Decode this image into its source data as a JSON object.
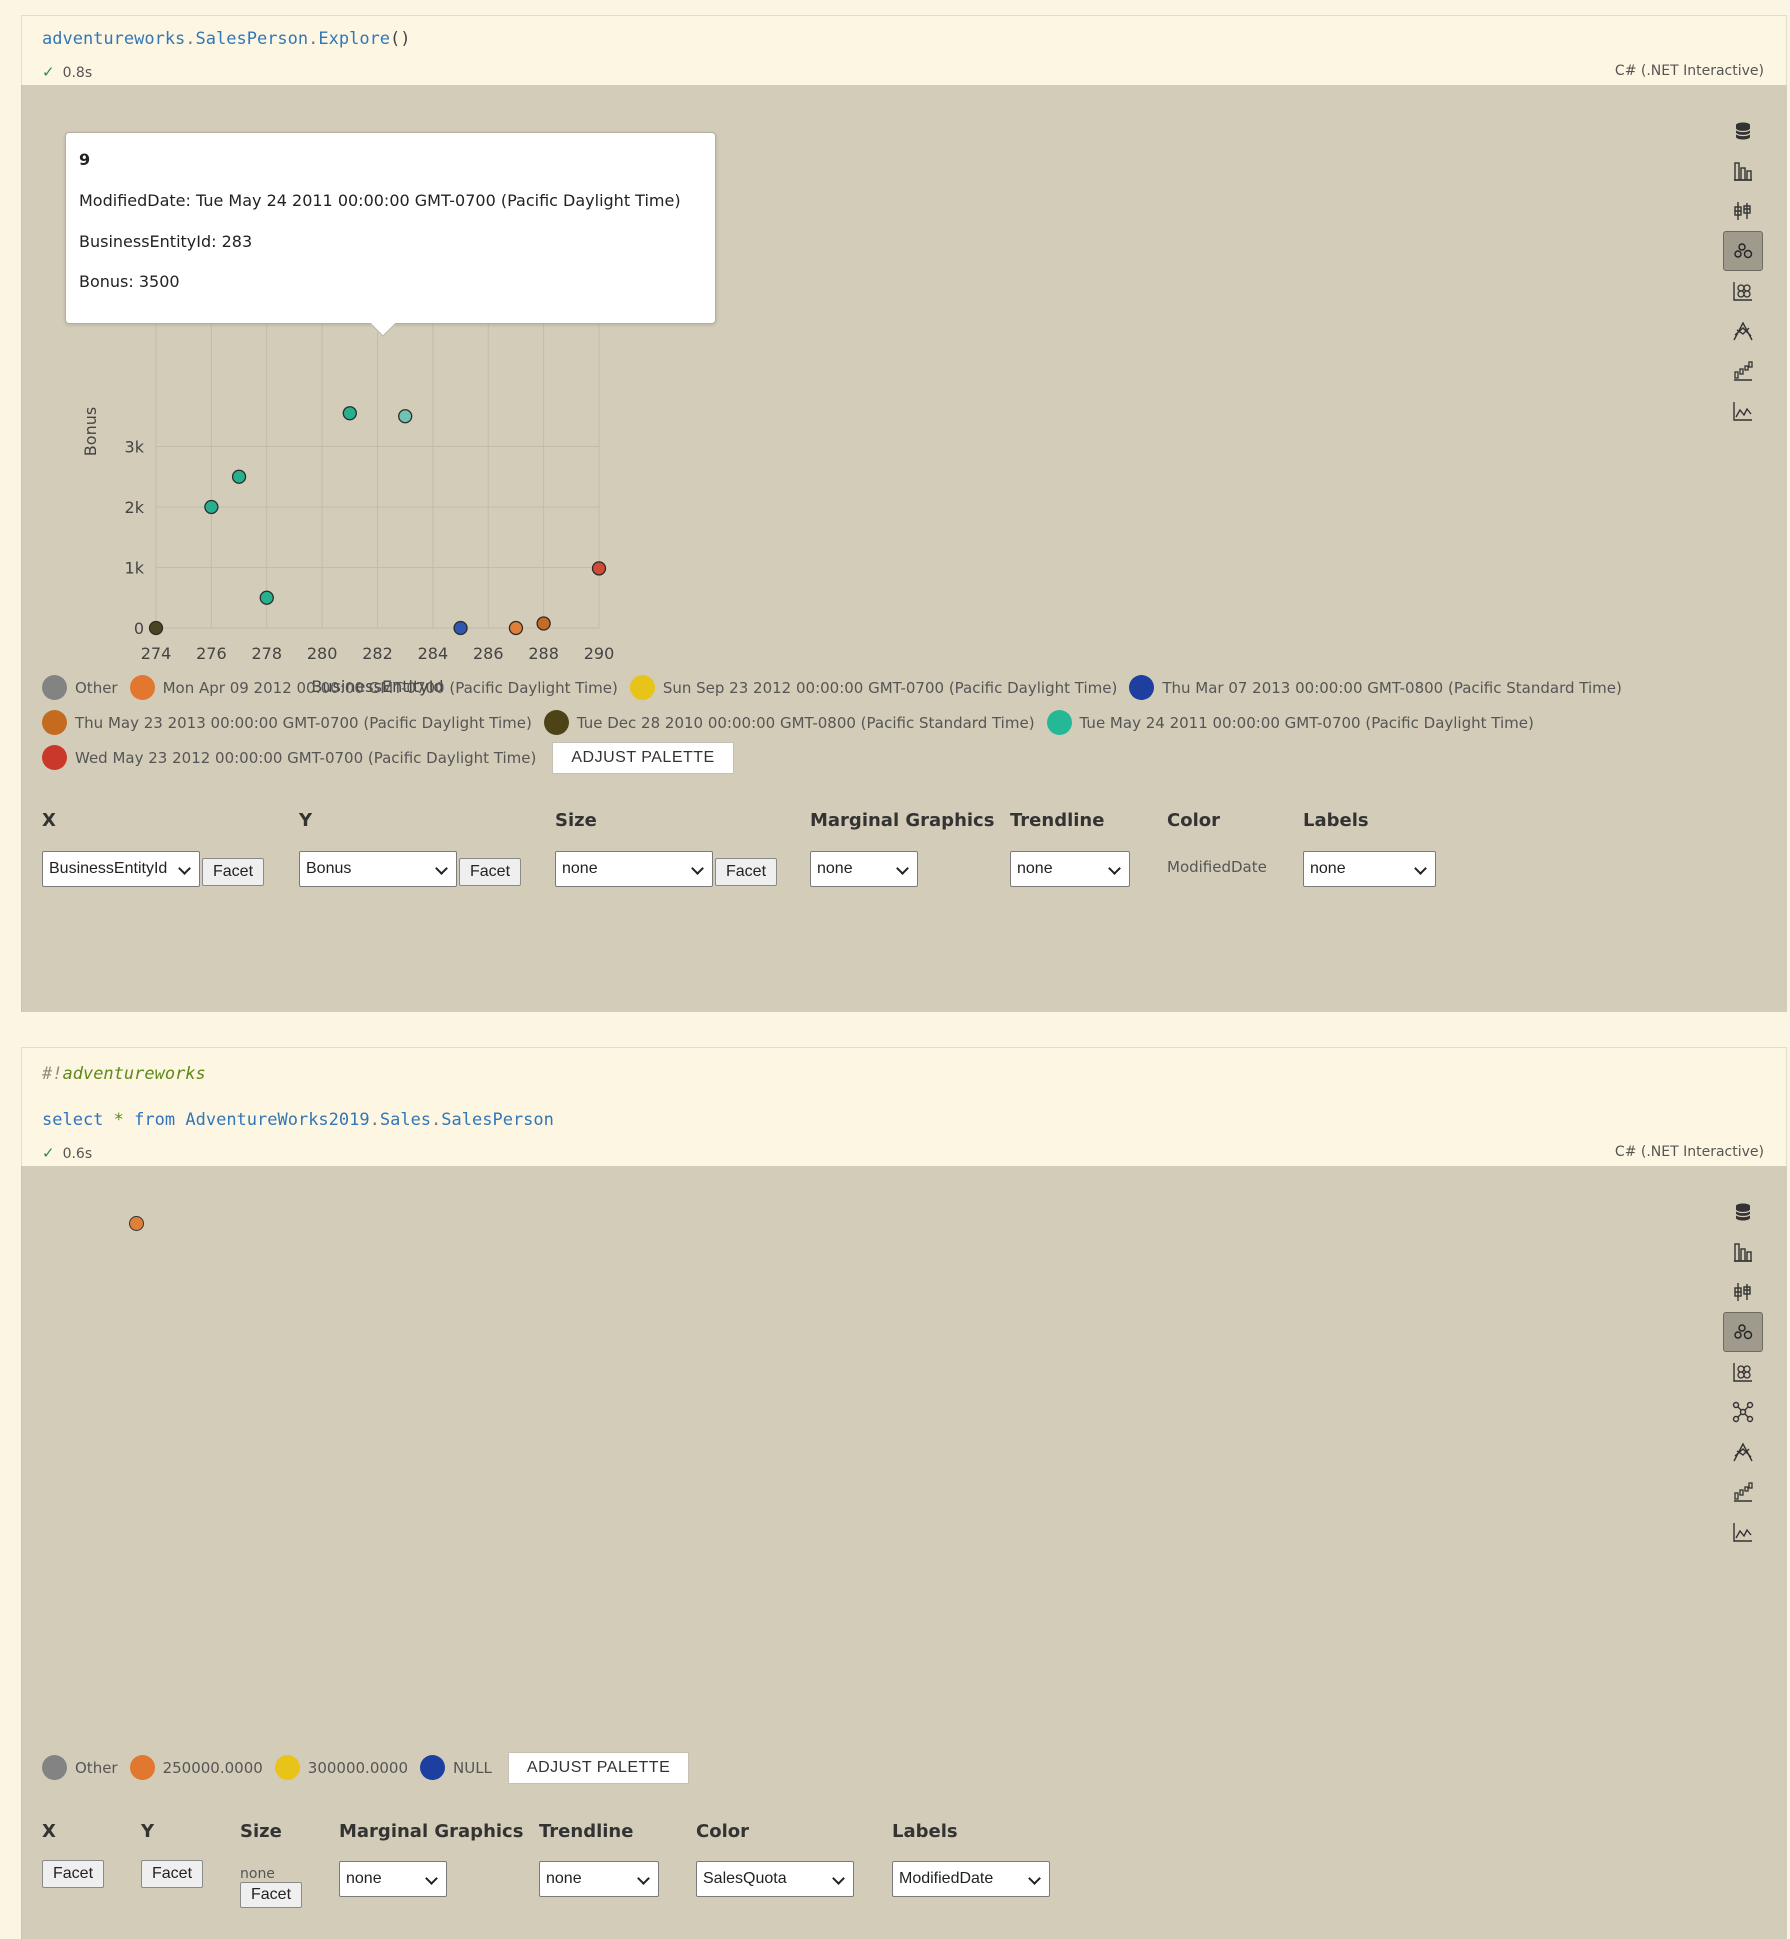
{
  "cell1": {
    "code": {
      "obj": "adventureworks",
      "dot1": ".",
      "table": "SalesPerson",
      "dot2": ".",
      "method": "Explore",
      "parens": "()"
    },
    "status": {
      "check": "✓",
      "time": "0.8s"
    },
    "language": "C# (.NET Interactive)",
    "tooltip": {
      "title": "9",
      "lines": [
        "ModifiedDate: Tue May 24 2011 00:00:00 GMT-0700 (Pacific Daylight Time)",
        "BusinessEntityId: 283",
        "Bonus: 3500"
      ]
    },
    "chart_data": {
      "type": "scatter",
      "xlabel": "BusinessEntityId",
      "ylabel": "Bonus",
      "xlim": [
        274,
        290
      ],
      "ylim": [
        0,
        3500
      ],
      "x_ticks": [
        "274",
        "276",
        "278",
        "280",
        "282",
        "284",
        "286",
        "288",
        "290"
      ],
      "y_ticks": [
        "0",
        "1k",
        "2k",
        "3k"
      ],
      "grid": true,
      "points": [
        {
          "x": 274,
          "y": 0,
          "color": "#4a4520"
        },
        {
          "x": 276,
          "y": 2000,
          "color": "#27b08e"
        },
        {
          "x": 277,
          "y": 2500,
          "color": "#27b08e"
        },
        {
          "x": 278,
          "y": 500,
          "color": "#27b08e"
        },
        {
          "x": 281,
          "y": 3550,
          "color": "#27b08e"
        },
        {
          "x": 283,
          "y": 3500,
          "color": "#6fc3b0"
        },
        {
          "x": 285,
          "y": 0,
          "color": "#2f56b0"
        },
        {
          "x": 287,
          "y": 0,
          "color": "#e07f3a"
        },
        {
          "x": 288,
          "y": 75,
          "color": "#c46d22"
        },
        {
          "x": 290,
          "y": 985,
          "color": "#d14a33"
        }
      ]
    },
    "legend_rows": [
      [
        {
          "label": "Other",
          "color": "#838383"
        },
        {
          "label": "Mon Apr 09 2012 00:00:00 GMT-0700 (Pacific Daylight Time)",
          "color": "#e2772f"
        },
        {
          "label": "Sun Sep 23 2012 00:00:00 GMT-0700 (Pacific Daylight Time)",
          "color": "#e8c318"
        },
        {
          "label": "Thu Mar 07 2013 00:00:00 GMT-0800 (Pacific Standard Time)",
          "color": "#1c3fa0"
        }
      ],
      [
        {
          "label": "Thu May 23 2013 00:00:00 GMT-0700 (Pacific Daylight Time)",
          "color": "#c46b1f"
        },
        {
          "label": "Tue Dec 28 2010 00:00:00 GMT-0800 (Pacific Standard Time)",
          "color": "#4c4416"
        },
        {
          "label": "Tue May 24 2011 00:00:00 GMT-0700 (Pacific Daylight Time)",
          "color": "#24b896"
        }
      ],
      [
        {
          "label": "Wed May 23 2012 00:00:00 GMT-0700 (Pacific Daylight Time)",
          "color": "#c9382a"
        }
      ]
    ],
    "adjust_palette": "ADJUST PALETTE",
    "controls": {
      "x_label": "X",
      "y_label": "Y",
      "size_label": "Size",
      "marginal_label": "Marginal Graphics",
      "trendline_label": "Trendline",
      "color_label": "Color",
      "labels_label": "Labels",
      "x_value": "BusinessEntityId",
      "y_value": "Bonus",
      "size_value": "none",
      "marginal_value": "none",
      "trendline_value": "none",
      "color_value": "ModifiedDate",
      "labels_value": "none",
      "facet": "Facet"
    },
    "toolbar": [
      "database-icon",
      "bar-chart-icon",
      "box-plot-icon",
      "scatter-icon",
      "bubble-icon",
      "parallel-icon",
      "waterfall-icon",
      "area-chart-icon"
    ]
  },
  "cell2": {
    "code_line1": {
      "prefix": "#!",
      "magic": "adventureworks"
    },
    "code_line2": {
      "kw1": "select",
      "star": "*",
      "kw2": "from",
      "db": "AdventureWorks2019",
      "dot1": ".",
      "schema": "Sales",
      "dot2": ".",
      "table": "SalesPerson"
    },
    "status": {
      "check": "✓",
      "time": "0.6s"
    },
    "language": "C# (.NET Interactive)",
    "legend_rows": [
      [
        {
          "label": "Other",
          "color": "#838383"
        },
        {
          "label": "250000.0000",
          "color": "#e2772f"
        },
        {
          "label": "300000.0000",
          "color": "#e8c318"
        },
        {
          "label": "NULL",
          "color": "#1c3fa0"
        }
      ]
    ],
    "adjust_palette": "ADJUST PALETTE",
    "controls": {
      "x_label": "X",
      "y_label": "Y",
      "size_label": "Size",
      "marginal_label": "Marginal Graphics",
      "trendline_label": "Trendline",
      "color_label": "Color",
      "labels_label": "Labels",
      "size_value": "none",
      "marginal_value": "none",
      "trendline_value": "none",
      "color_value": "SalesQuota",
      "labels_value": "ModifiedDate",
      "facet": "Facet"
    },
    "toolbar": [
      "database-icon",
      "bar-chart-icon",
      "box-plot-icon",
      "scatter-icon",
      "bubble-icon",
      "network-icon",
      "parallel-icon",
      "waterfall-icon",
      "area-chart-icon"
    ]
  }
}
